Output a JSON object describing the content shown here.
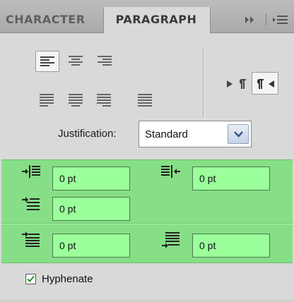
{
  "tabs": [
    {
      "label": "CHARACTER",
      "active": false
    },
    {
      "label": "PARAGRAPH",
      "active": true
    }
  ],
  "tab_icons": {
    "collapse": "double-chevron-right-icon",
    "menu": "panel-menu-icon"
  },
  "alignment": {
    "row1": [
      {
        "name": "align-left",
        "selected": true
      },
      {
        "name": "align-center",
        "selected": false
      },
      {
        "name": "align-right",
        "selected": false
      }
    ],
    "row2": [
      {
        "name": "justify-last-left"
      },
      {
        "name": "justify-last-center"
      },
      {
        "name": "justify-last-right"
      },
      {
        "name": "justify-all"
      }
    ]
  },
  "direction": {
    "ltr": {
      "icon": "left-to-right-paragraph-icon",
      "selected": false
    },
    "rtl": {
      "icon": "right-to-left-paragraph-icon",
      "selected": true
    }
  },
  "justification": {
    "label": "Justification:",
    "value": "Standard"
  },
  "indents": {
    "left_indent": "0 pt",
    "right_indent": "0 pt",
    "first_line_indent": "0 pt"
  },
  "spacing": {
    "space_before": "0 pt",
    "space_after": "0 pt"
  },
  "hyphenate": {
    "label": "Hyphenate",
    "checked": true
  },
  "colors": {
    "highlight": "#86df86",
    "field": "#9bff9b",
    "panel": "#d9d9d9"
  }
}
